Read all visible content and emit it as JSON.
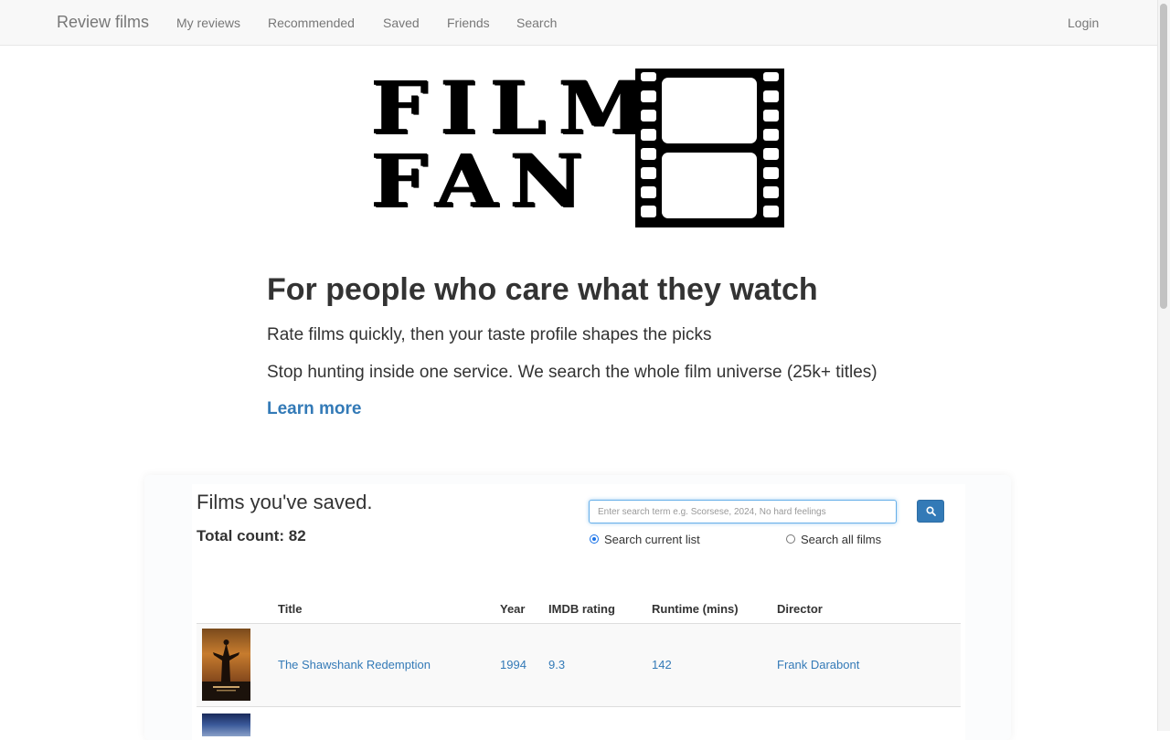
{
  "navbar": {
    "brand": "Review films",
    "links": [
      "My reviews",
      "Recommended",
      "Saved",
      "Friends",
      "Search"
    ],
    "login": "Login"
  },
  "logo": {
    "line1": "FILM",
    "line2": "FAN"
  },
  "hero": {
    "title": "For people who care what they watch",
    "line1": "Rate films quickly, then your taste profile shapes the picks",
    "line2": "Stop hunting inside one service. We search the whole film universe (25k+ titles)",
    "learn_more": "Learn more"
  },
  "saved": {
    "title": "Films you've saved.",
    "total_label": "Total count:",
    "total_value": "82",
    "search_placeholder": "Enter search term e.g. Scorsese, 2024, No hard feelings",
    "search_icon": "search-icon",
    "radio_current": "Search current list",
    "radio_all": "Search all films",
    "selected_scope": "current"
  },
  "table": {
    "columns": [
      "Title",
      "Year",
      "IMDB rating",
      "Runtime (mins)",
      "Director"
    ],
    "rows": [
      {
        "title": "The Shawshank Redemption",
        "year": "1994",
        "imdb": "9.3",
        "runtime": "142",
        "director": "Frank Darabont"
      }
    ]
  },
  "colors": {
    "link": "#337ab7",
    "navbar_bg": "#f8f8f8",
    "button_primary": "#337ab7",
    "focus_border": "#66afe9"
  }
}
